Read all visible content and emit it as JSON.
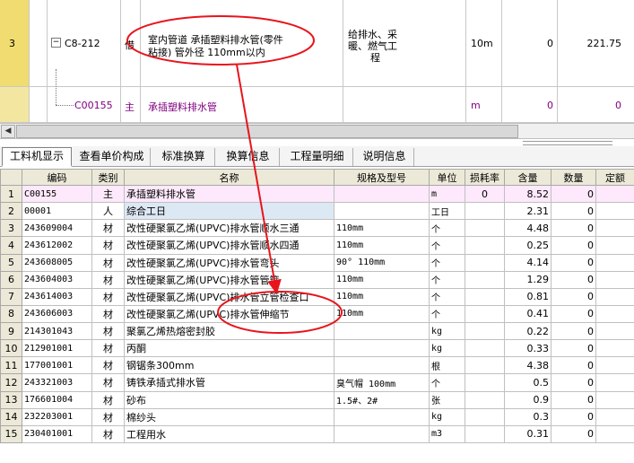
{
  "top_grid": {
    "row1": {
      "index": "3",
      "tree_toggle": "−",
      "code": "C8-212",
      "category": "借",
      "name_line1": "室内管道 承插塑料排水管(零件",
      "name_line2": "粘接) 管外径 110mm以内",
      "specialty_line1": "给排水、采",
      "specialty_line2": "暖、燃气工",
      "specialty_line3": "程",
      "unit": "10m",
      "value1": "0",
      "value2": "221.75"
    },
    "row2": {
      "code": "C00155",
      "category": "主",
      "name": "承插塑料排水管",
      "unit": "m",
      "value1": "0",
      "value2": "0"
    }
  },
  "tabs": [
    {
      "label": "工料机显示"
    },
    {
      "label": "查看单价构成"
    },
    {
      "label": "标准换算"
    },
    {
      "label": "换算信息"
    },
    {
      "label": "工程量明细"
    },
    {
      "label": "说明信息"
    }
  ],
  "table": {
    "headers": [
      "",
      "编码",
      "类别",
      "名称",
      "规格及型号",
      "单位",
      "损耗率",
      "含量",
      "数量",
      "定额"
    ],
    "rows": [
      {
        "n": "1",
        "code": "C00155",
        "type": "主",
        "name": "承插塑料排水管",
        "spec": "",
        "unit": "m",
        "loss": "0",
        "content": "8.52",
        "qty": "0"
      },
      {
        "n": "2",
        "code": "00001",
        "type": "人",
        "name": "综合工日",
        "spec": "",
        "unit": "工日",
        "loss": "",
        "content": "2.31",
        "qty": "0"
      },
      {
        "n": "3",
        "code": "243609004",
        "type": "材",
        "name": "改性硬聚氯乙烯(UPVC)排水管顺水三通",
        "spec": "110mm",
        "unit": "个",
        "loss": "",
        "content": "4.48",
        "qty": "0"
      },
      {
        "n": "4",
        "code": "243612002",
        "type": "材",
        "name": "改性硬聚氯乙烯(UPVC)排水管顺水四通",
        "spec": "110mm",
        "unit": "个",
        "loss": "",
        "content": "0.25",
        "qty": "0"
      },
      {
        "n": "5",
        "code": "243608005",
        "type": "材",
        "name": "改性硬聚氯乙烯(UPVC)排水管弯头",
        "spec": "90°  110mm",
        "unit": "个",
        "loss": "",
        "content": "4.14",
        "qty": "0"
      },
      {
        "n": "6",
        "code": "243604003",
        "type": "材",
        "name": "改性硬聚氯乙烯(UPVC)排水管管箍",
        "spec": "110mm",
        "unit": "个",
        "loss": "",
        "content": "1.29",
        "qty": "0"
      },
      {
        "n": "7",
        "code": "243614003",
        "type": "材",
        "name": "改性硬聚氯乙烯(UPVC)排水管立管检查口",
        "spec": "110mm",
        "unit": "个",
        "loss": "",
        "content": "0.81",
        "qty": "0"
      },
      {
        "n": "8",
        "code": "243606003",
        "type": "材",
        "name": "改性硬聚氯乙烯(UPVC)排水管伸缩节",
        "spec": "110mm",
        "unit": "个",
        "loss": "",
        "content": "0.41",
        "qty": "0"
      },
      {
        "n": "9",
        "code": "214301043",
        "type": "材",
        "name": "聚氯乙烯热熔密封胶",
        "spec": "",
        "unit": "kg",
        "loss": "",
        "content": "0.22",
        "qty": "0"
      },
      {
        "n": "10",
        "code": "212901001",
        "type": "材",
        "name": "丙酮",
        "spec": "",
        "unit": "kg",
        "loss": "",
        "content": "0.33",
        "qty": "0"
      },
      {
        "n": "11",
        "code": "177001001",
        "type": "材",
        "name": "钢锯条300mm",
        "spec": "",
        "unit": "根",
        "loss": "",
        "content": "4.38",
        "qty": "0"
      },
      {
        "n": "12",
        "code": "243321003",
        "type": "材",
        "name": "铸铁承插式排水管",
        "spec": "臭气帽 100mm",
        "unit": "个",
        "loss": "",
        "content": "0.5",
        "qty": "0"
      },
      {
        "n": "13",
        "code": "176601004",
        "type": "材",
        "name": "砂布",
        "spec": "1.5#、2#",
        "unit": "张",
        "loss": "",
        "content": "0.9",
        "qty": "0"
      },
      {
        "n": "14",
        "code": "232203001",
        "type": "材",
        "name": "棉纱头",
        "spec": "",
        "unit": "kg",
        "loss": "",
        "content": "0.3",
        "qty": "0"
      },
      {
        "n": "15",
        "code": "230401001",
        "type": "材",
        "name": "工程用水",
        "spec": "",
        "unit": "m3",
        "loss": "",
        "content": "0.31",
        "qty": "0"
      }
    ]
  },
  "colors": {
    "annotation": "#e8141c",
    "selected_row": "#fde9fb",
    "name_highlight": "#dde8f5",
    "top_index_bg": "#f0dc70"
  }
}
